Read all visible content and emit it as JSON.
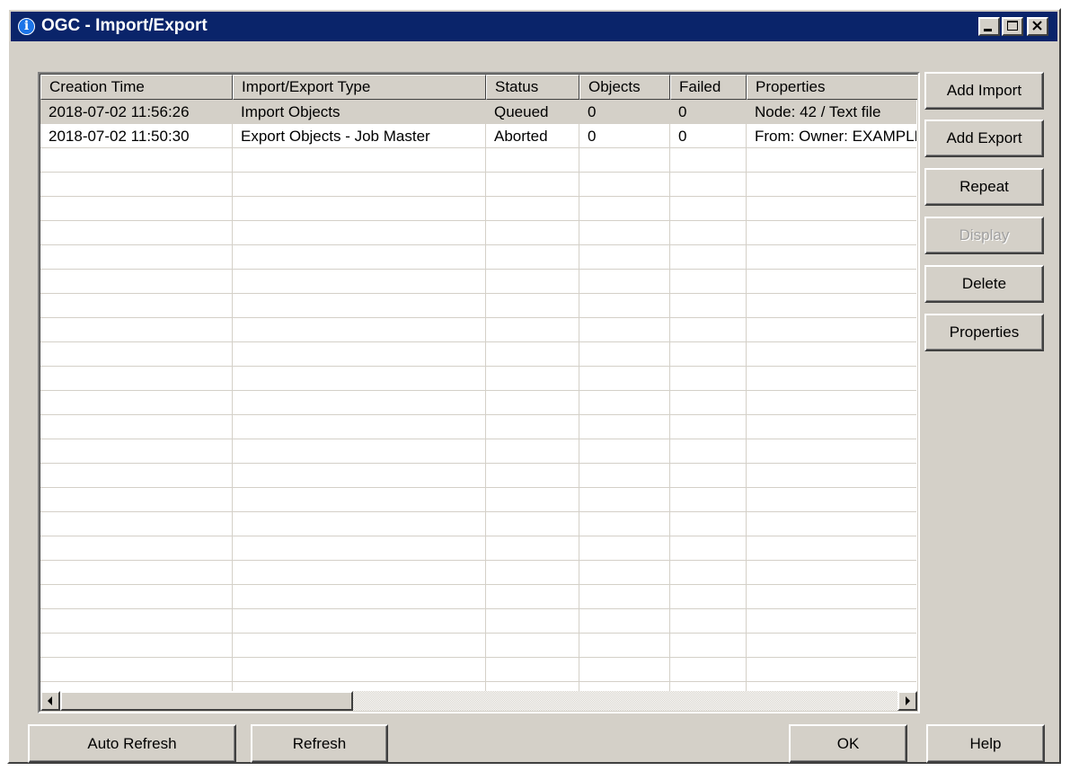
{
  "window": {
    "title": "OGC - Import/Export"
  },
  "table": {
    "columns": [
      "Creation Time",
      "Import/Export Type",
      "Status",
      "Objects",
      "Failed",
      "Properties"
    ],
    "rows": [
      {
        "creation_time": "2018-07-02 11:56:26",
        "type": "Import Objects",
        "status": "Queued",
        "objects": "0",
        "failed": "0",
        "properties": "Node: 42 / Text file",
        "selected": true
      },
      {
        "creation_time": "2018-07-02 11:50:30",
        "type": "Export Objects - Job Master",
        "status": "Aborted",
        "objects": "0",
        "failed": "0",
        "properties": "From: Owner: EXAMPLE",
        "selected": false
      }
    ],
    "empty_rows": 22
  },
  "side_buttons": {
    "add_import": "Add Import",
    "add_export": "Add Export",
    "repeat": "Repeat",
    "display": "Display",
    "delete": "Delete",
    "properties": "Properties"
  },
  "bottom_buttons": {
    "auto_refresh": "Auto Refresh",
    "refresh": "Refresh",
    "ok": "OK",
    "help": "Help"
  },
  "icons": {
    "title": "info-icon",
    "minimize": "minimize-icon",
    "maximize": "maximize-icon",
    "close": "close-icon",
    "scroll_left": "arrow-left-icon",
    "scroll_right": "arrow-right-icon"
  },
  "colors": {
    "titlebar": "#0a246a",
    "face": "#d4d0c8",
    "selected_row": "#d4d0c8"
  }
}
